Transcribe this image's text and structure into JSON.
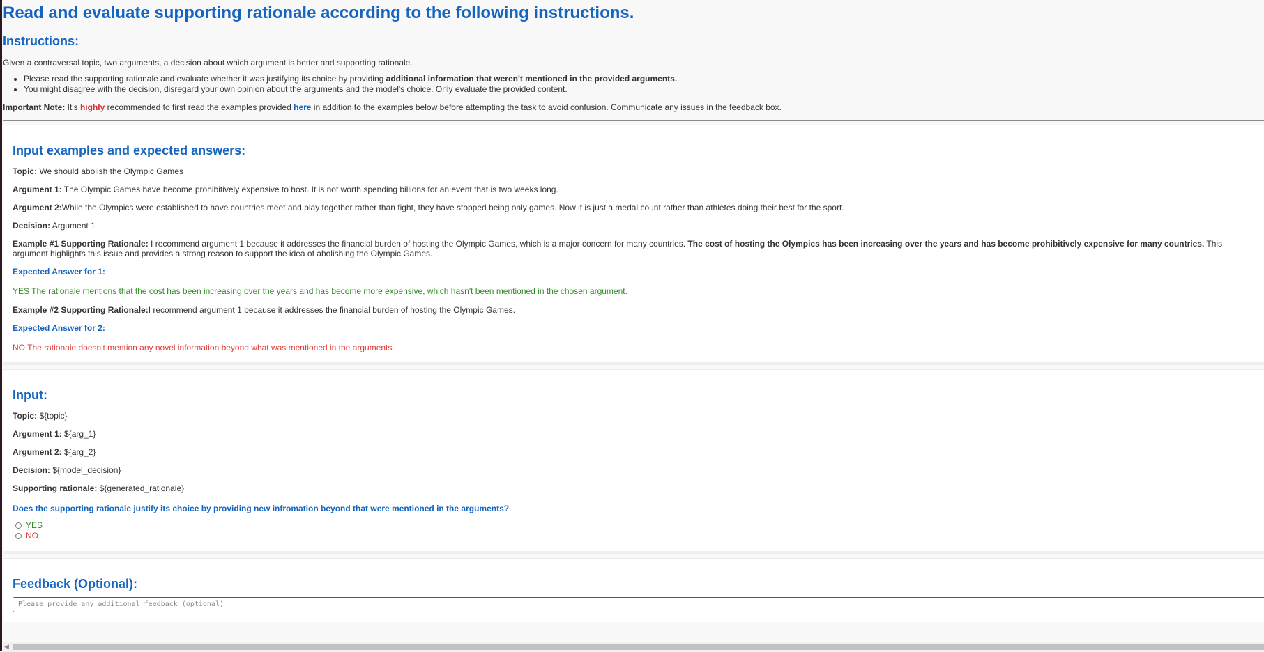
{
  "header": {
    "title": "Read and evaluate supporting rationale according to the following instructions.",
    "instructions_heading": "Instructions:",
    "intro": "Given a contraversal topic, two arguments, a decision about which argument is better and supporting rationale.",
    "bullet1_prefix": "Please read the supporting rationale and evaluate whether it was justifying its choice by providing ",
    "bullet1_bold": "additional information that weren't mentioned in the provided arguments.",
    "bullet2": "You might disagree with the decision, disregard your own opinion about the arguments and the model's choice. Only evaluate the provided content.",
    "note_label": "Important Note:",
    "note_pre": " It's ",
    "note_highlight": "highly",
    "note_mid": " recommended to first read the examples provided ",
    "note_link": "here",
    "note_post": " in addition to the examples below before attempting the task to avoid confusion. Communicate any issues in the feedback box."
  },
  "examples": {
    "heading": "Input examples and expected answers:",
    "topic_label": "Topic:",
    "topic": " We should abolish the Olympic Games",
    "arg1_label": "Argument 1:",
    "arg1": " The Olympic Games have become prohibitively expensive to host. It is not worth spending billions for an event that is two weeks long.",
    "arg2_label": "Argument 2:",
    "arg2": "While the Olympics were established to have countries meet and play together rather than fight, they have stopped being only games. Now it is just a medal count rather than athletes doing their best for the sport.",
    "decision_label": "Decision:",
    "decision": " Argument 1",
    "ex1_label": "Example #1 Supporting Rationale:",
    "ex1_pre": " I recommend argument 1 because it addresses the financial burden of hosting the Olympic Games, which is a major concern for many countries. ",
    "ex1_bold": "The cost of hosting the Olympics has been increasing over the years and has become prohibitively expensive for many countries.",
    "ex1_post": " This argument highlights this issue and provides a strong reason to support the idea of abolishing the Olympic Games.",
    "ans1_label": "Expected Answer for 1:",
    "ans1": "YES The rationale mentions that the cost has been increasing over the years and has become more expensive, which hasn't been mentioned in the chosen argument.",
    "ex2_label": "Example #2 Supporting Rationale:",
    "ex2": "I recommend argument 1 because it addresses the financial burden of hosting the Olympic Games.",
    "ans2_label": "Expected Answer for 2:",
    "ans2": "NO The rationale doesn't mention any novel information beyond what was mentioned in the arguments."
  },
  "input": {
    "heading": "Input:",
    "topic_label": "Topic:",
    "topic": " ${topic}",
    "arg1_label": "Argument 1:",
    "arg1": " ${arg_1}",
    "arg2_label": "Argument 2:",
    "arg2": " ${arg_2}",
    "decision_label": "Decision:",
    "decision": " ${model_decision}",
    "rationale_label": "Supporting rationale:",
    "rationale": " ${generated_rationale}",
    "question": "Does the supporting rationale justify its choice by providing new infromation beyond that were mentioned in the arguments?",
    "option_yes": "YES",
    "option_no": "NO"
  },
  "feedback": {
    "heading": "Feedback (Optional):",
    "placeholder": "Please provide any additional feedback (optional)"
  },
  "colors": {
    "accent": "#1565c0",
    "yes": "#2e8b22",
    "no": "#e53935",
    "highlight": "#d32f2f"
  }
}
